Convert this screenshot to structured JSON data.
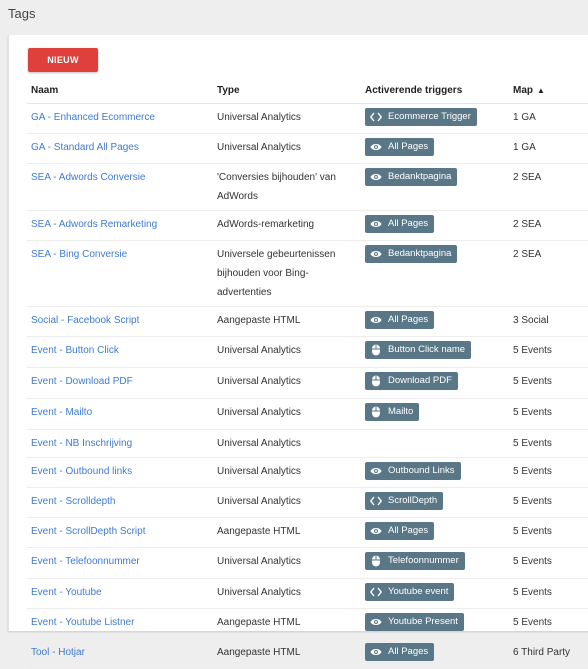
{
  "page": {
    "title": "Tags"
  },
  "toolbar": {
    "new_label": "NIEUW"
  },
  "table": {
    "headers": {
      "name": "Naam",
      "type": "Type",
      "triggers": "Activerende triggers",
      "folder": "Map"
    },
    "rows": [
      {
        "name": "GA - Enhanced Ecommerce",
        "type": "Universal Analytics",
        "trigger": "Ecommerce Trigger",
        "trigger_icon": "code-icon",
        "folder": "1 GA"
      },
      {
        "name": "GA - Standard All Pages",
        "type": "Universal Analytics",
        "trigger": "All Pages",
        "trigger_icon": "eye-icon",
        "folder": "1 GA"
      },
      {
        "name": "SEA - Adwords Conversie",
        "type": "'Conversies bijhouden' van AdWords",
        "trigger": "Bedanktpagina",
        "trigger_icon": "eye-icon",
        "folder": "2 SEA"
      },
      {
        "name": "SEA - Adwords Remarketing",
        "type": "AdWords-remarketing",
        "trigger": "All Pages",
        "trigger_icon": "eye-icon",
        "folder": "2 SEA"
      },
      {
        "name": "SEA - Bing Conversie",
        "type": "Universele gebeurtenissen bijhouden voor Bing-advertenties",
        "trigger": "Bedanktpagina",
        "trigger_icon": "eye-icon",
        "folder": "2 SEA"
      },
      {
        "name": "Social - Facebook Script",
        "type": "Aangepaste HTML",
        "trigger": "All Pages",
        "trigger_icon": "eye-icon",
        "folder": "3 Social"
      },
      {
        "name": "Event - Button Click",
        "type": "Universal Analytics",
        "trigger": "Button Click name",
        "trigger_icon": "mouse-icon",
        "folder": "5 Events"
      },
      {
        "name": "Event - Download PDF",
        "type": "Universal Analytics",
        "trigger": "Download PDF",
        "trigger_icon": "mouse-icon",
        "folder": "5 Events"
      },
      {
        "name": "Event - Mailto",
        "type": "Universal Analytics",
        "trigger": "Mailto",
        "trigger_icon": "mouse-icon",
        "folder": "5 Events"
      },
      {
        "name": "Event - NB Inschrijving",
        "type": "Universal Analytics",
        "trigger": "",
        "trigger_icon": "",
        "folder": "5 Events"
      },
      {
        "name": "Event - Outbound links",
        "type": "Universal Analytics",
        "trigger": "Outbound Links",
        "trigger_icon": "eye-icon",
        "folder": "5 Events"
      },
      {
        "name": "Event - Scrolldepth",
        "type": "Universal Analytics",
        "trigger": "ScrollDepth",
        "trigger_icon": "code-icon",
        "folder": "5 Events"
      },
      {
        "name": "Event - ScrollDepth Script",
        "type": "Aangepaste HTML",
        "trigger": "All Pages",
        "trigger_icon": "eye-icon",
        "folder": "5 Events"
      },
      {
        "name": "Event - Telefoonnummer",
        "type": "Universal Analytics",
        "trigger": "Telefoonnummer",
        "trigger_icon": "mouse-icon",
        "folder": "5 Events"
      },
      {
        "name": "Event - Youtube",
        "type": "Universal Analytics",
        "trigger": "Youtube event",
        "trigger_icon": "code-icon",
        "folder": "5 Events"
      },
      {
        "name": "Event - Youtube Listner",
        "type": "Aangepaste HTML",
        "trigger": "Youtube Present",
        "trigger_icon": "eye-icon",
        "folder": "5 Events"
      },
      {
        "name": "Tool - Hotjar",
        "type": "Aangepaste HTML",
        "trigger": "All Pages",
        "trigger_icon": "eye-icon",
        "folder": "6 Third Party"
      }
    ]
  },
  "colors": {
    "accent": "#e0403b",
    "link": "#3e7bd1",
    "chip": "#5a7788"
  }
}
